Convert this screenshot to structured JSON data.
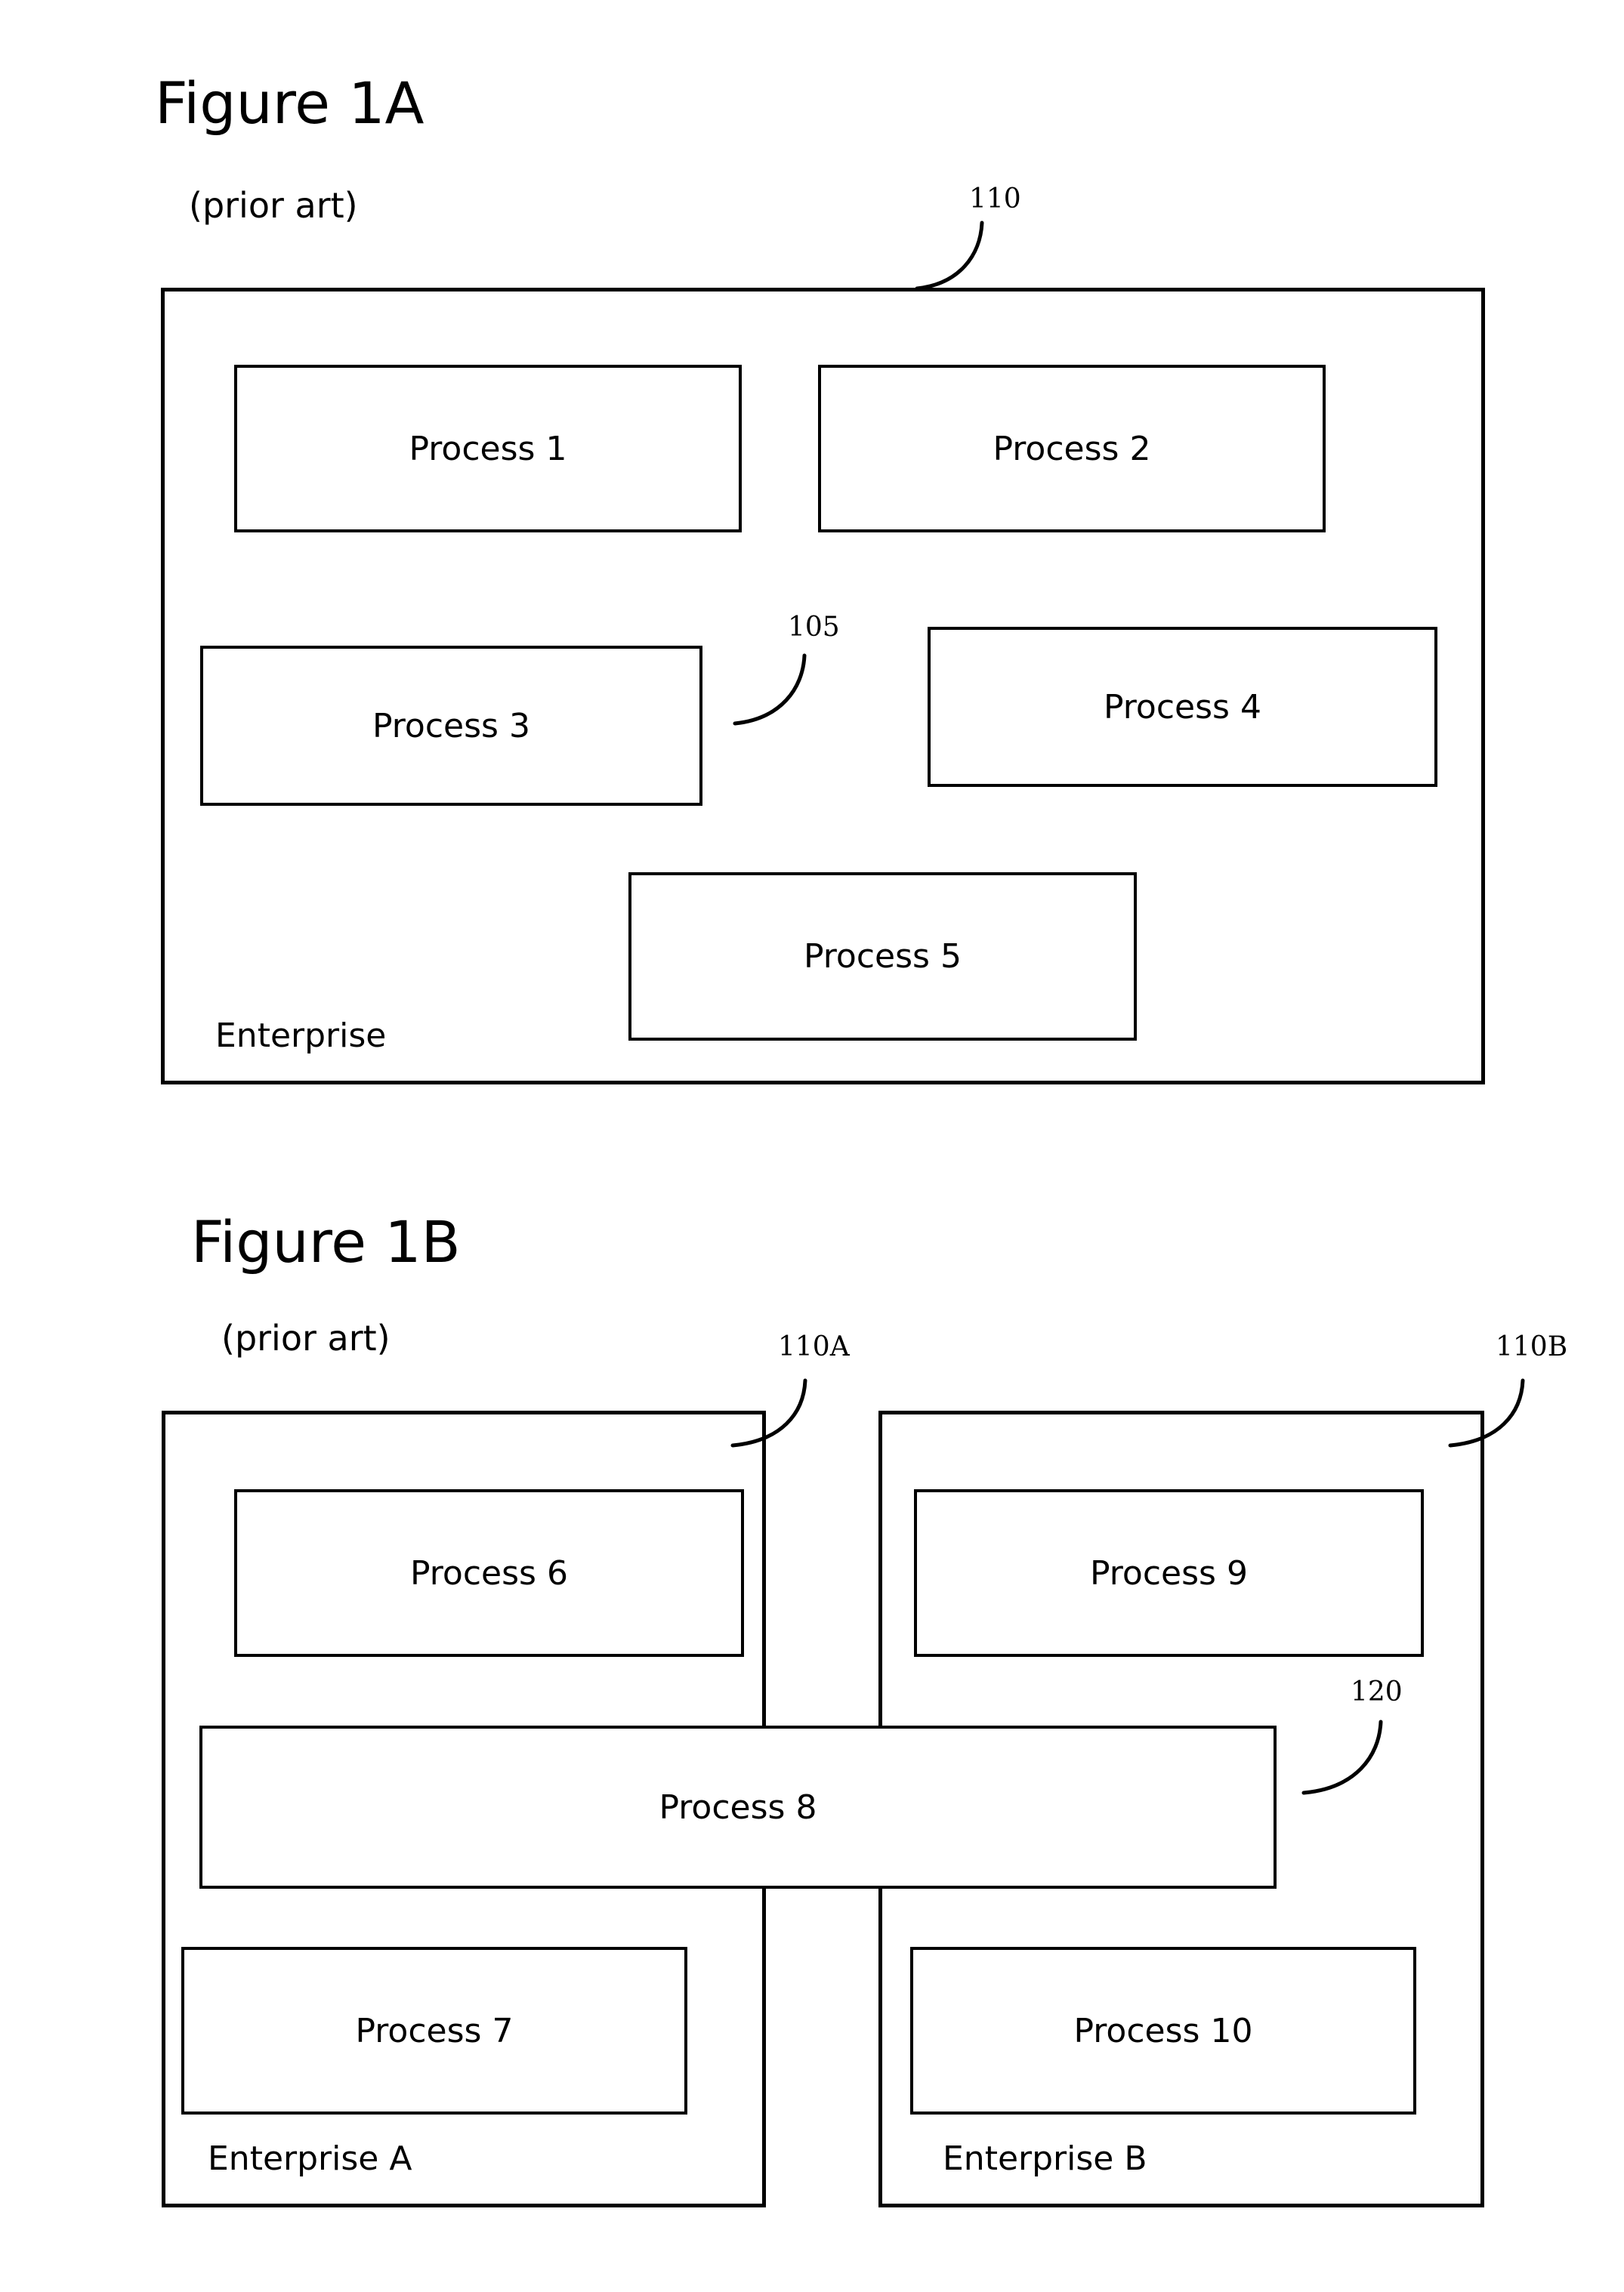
{
  "document": {
    "type": "patent-figure-sheet",
    "background_color": "#ffffff",
    "line_color": "#000000"
  },
  "figures": [
    {
      "id": "figure-1a",
      "title": "Figure 1A",
      "subtitle": "(prior art)",
      "container": {
        "label": "Enterprise",
        "ref": "110"
      },
      "processes": [
        {
          "label": "Process 1"
        },
        {
          "label": "Process 2"
        },
        {
          "label": "Process 3",
          "ref": "105"
        },
        {
          "label": "Process 4"
        },
        {
          "label": "Process 5"
        }
      ],
      "callouts": [
        {
          "text": "110",
          "target": "enterprise-container"
        },
        {
          "text": "105",
          "target": "process-3"
        }
      ]
    },
    {
      "id": "figure-1b",
      "title": "Figure 1B",
      "subtitle": "(prior art)",
      "containers": [
        {
          "label": "Enterprise A",
          "ref": "110A"
        },
        {
          "label": "Enterprise B",
          "ref": "110B"
        }
      ],
      "processes": [
        {
          "label": "Process 6"
        },
        {
          "label": "Process 9"
        },
        {
          "label": "Process 8",
          "ref": "120"
        },
        {
          "label": "Process 7"
        },
        {
          "label": "Process 10"
        }
      ],
      "callouts": [
        {
          "text": "110A",
          "target": "enterprise-a-container"
        },
        {
          "text": "110B",
          "target": "enterprise-b-container"
        },
        {
          "text": "120",
          "target": "process-8"
        }
      ]
    }
  ]
}
